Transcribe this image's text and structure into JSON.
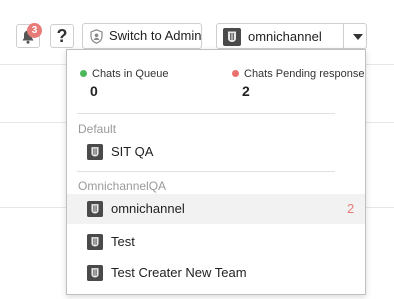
{
  "colors": {
    "accent_count": "#e77b78",
    "queue_dot": "#4cb85c",
    "pending_dot": "#e8716f",
    "badge_bg": "#e77b78",
    "active_row_bg": "#f2f2f2"
  },
  "header": {
    "notification_count": "3",
    "help_label": "?",
    "switch_label": "Switch to Admin",
    "team_selected": "omnichannel"
  },
  "icons": {
    "bell": "bell-icon",
    "shield": "shield-icon",
    "team_logo": "team-logo-icon",
    "caret": "caret-down-icon"
  },
  "dropdown": {
    "stats": [
      {
        "label": "Chats in Queue",
        "value": "0",
        "dot": "green"
      },
      {
        "label": "Chats Pending response",
        "value": "2",
        "dot": "red"
      }
    ],
    "groups": [
      {
        "name": "Default",
        "teams": [
          {
            "name": "SIT QA",
            "count": ""
          }
        ]
      },
      {
        "name": "OmnichannelQA",
        "teams": [
          {
            "name": "omnichannel",
            "count": "2",
            "active": true
          },
          {
            "name": "Test",
            "count": ""
          },
          {
            "name": "Test Creater New Team",
            "count": ""
          }
        ]
      }
    ]
  }
}
